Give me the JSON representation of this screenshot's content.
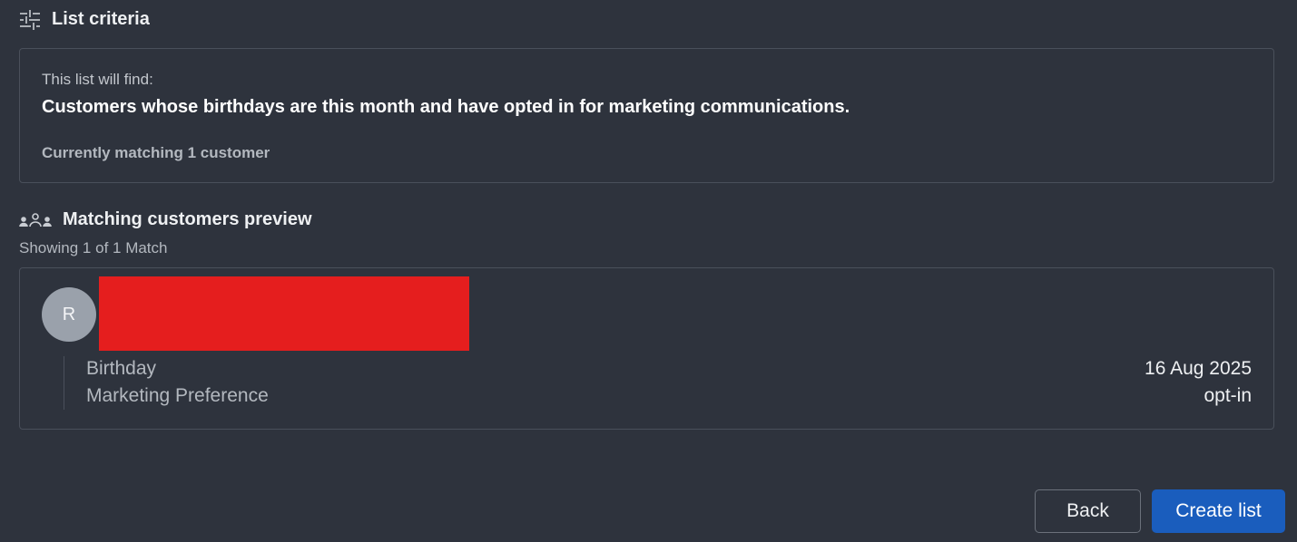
{
  "criteria": {
    "title": "List criteria",
    "icon": "sliders-icon",
    "intro": "This list will find:",
    "description": "Customers whose birthdays are this month and have opted in for marketing communications.",
    "matching": "Currently matching 1 customer"
  },
  "preview": {
    "title": "Matching customers preview",
    "icon": "users-group-icon",
    "showing": "Showing 1 of 1 Match",
    "customers": [
      {
        "avatar_initial": "R",
        "name_redacted": true,
        "details": [
          {
            "label": "Birthday",
            "value": "16 Aug 2025"
          },
          {
            "label": "Marketing Preference",
            "value": "opt-in"
          }
        ]
      }
    ]
  },
  "actions": {
    "back_label": "Back",
    "create_label": "Create list"
  },
  "colors": {
    "background": "#2e333d",
    "border": "#4a505b",
    "primary": "#1a5dbd",
    "redaction": "#e51e1e",
    "avatar": "#9aa1ab"
  }
}
